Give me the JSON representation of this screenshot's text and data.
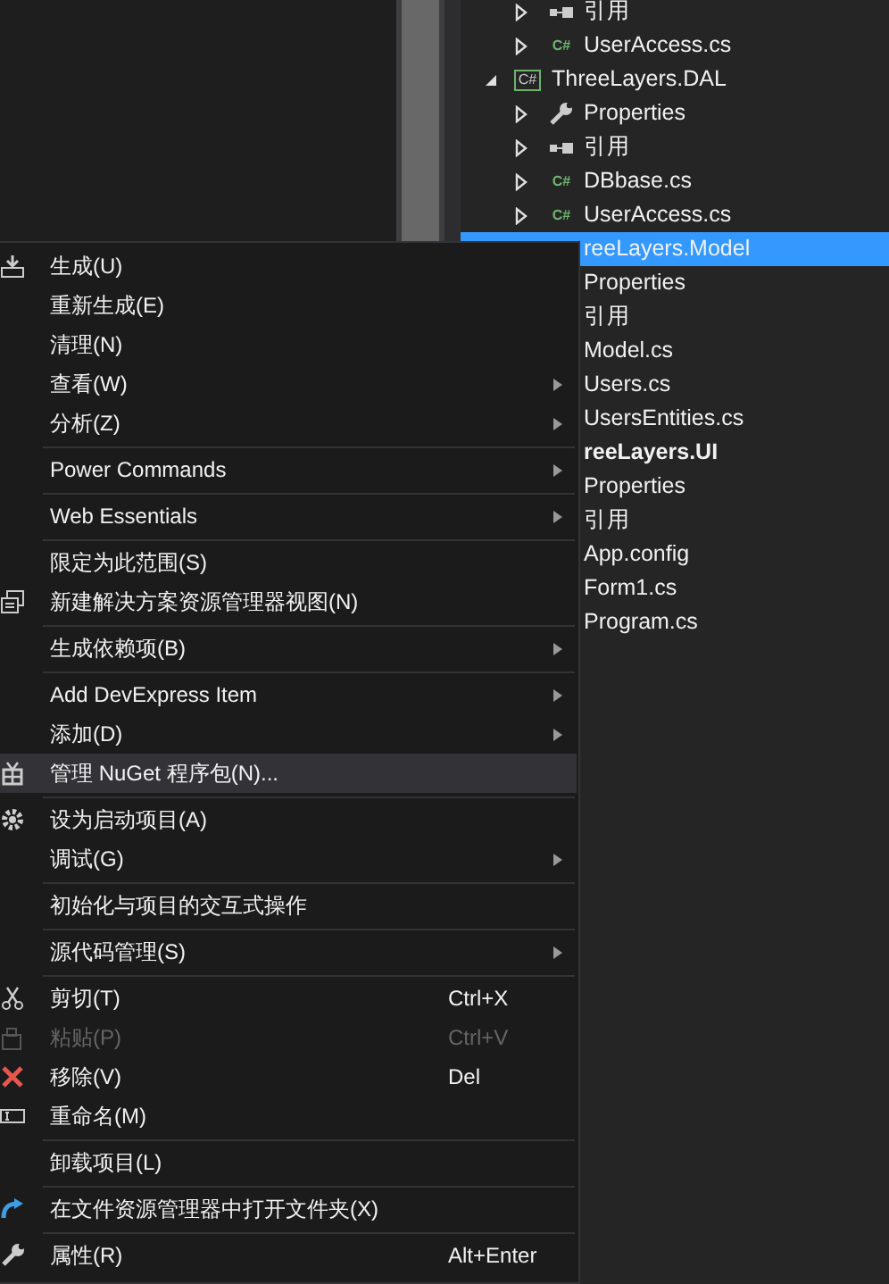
{
  "solution_explorer": {
    "leading_items": [
      {
        "label": "引用",
        "kind": "references",
        "expandable": true
      },
      {
        "label": "UserAccess.cs",
        "kind": "csharp",
        "icon_text": "C#",
        "expandable": true
      }
    ],
    "projects": [
      {
        "label": "ThreeLayers.DAL",
        "kind": "project",
        "icon_text": "C#",
        "expanded": true,
        "selected": false,
        "startup": false,
        "children": [
          {
            "label": "Properties",
            "kind": "properties",
            "expandable": true
          },
          {
            "label": "引用",
            "kind": "references",
            "expandable": true
          },
          {
            "label": "DBbase.cs",
            "kind": "csharp",
            "icon_text": "C#",
            "expandable": true
          },
          {
            "label": "UserAccess.cs",
            "kind": "csharp",
            "icon_text": "C#",
            "expandable": true
          }
        ]
      },
      {
        "label": "reeLayers.Model",
        "selected": true,
        "startup": false,
        "children": [
          {
            "label": "Properties"
          },
          {
            "label": "引用"
          },
          {
            "label": "Model.cs"
          },
          {
            "label": "Users.cs"
          },
          {
            "label": "UsersEntities.cs"
          }
        ]
      },
      {
        "label": "reeLayers.UI",
        "selected": false,
        "startup": true,
        "children": [
          {
            "label": "Properties"
          },
          {
            "label": "引用"
          },
          {
            "label": "App.config"
          },
          {
            "label": "Form1.cs"
          },
          {
            "label": "Program.cs"
          }
        ]
      }
    ]
  },
  "context_menu": [
    {
      "kind": "item",
      "label": "生成(U)",
      "submenu": false,
      "disabled": false,
      "selected": false
    },
    {
      "kind": "item",
      "label": "重新生成(E)",
      "submenu": false,
      "disabled": false,
      "selected": false
    },
    {
      "kind": "item",
      "label": "清理(N)",
      "submenu": false,
      "disabled": false,
      "selected": false
    },
    {
      "kind": "item",
      "label": "查看(W)",
      "submenu": true,
      "disabled": false,
      "selected": false
    },
    {
      "kind": "item",
      "label": "分析(Z)",
      "submenu": true,
      "disabled": false,
      "selected": false
    },
    {
      "kind": "separator"
    },
    {
      "kind": "item",
      "label": "Power Commands",
      "submenu": true,
      "disabled": false,
      "selected": false
    },
    {
      "kind": "separator"
    },
    {
      "kind": "item",
      "label": "Web Essentials",
      "submenu": true,
      "disabled": false,
      "selected": false
    },
    {
      "kind": "separator"
    },
    {
      "kind": "item",
      "label": "限定为此范围(S)",
      "submenu": false,
      "disabled": false,
      "selected": false
    },
    {
      "kind": "item",
      "label": "新建解决方案资源管理器视图(N)",
      "submenu": false,
      "disabled": false,
      "selected": false
    },
    {
      "kind": "separator"
    },
    {
      "kind": "item",
      "label": "生成依赖项(B)",
      "submenu": true,
      "disabled": false,
      "selected": false
    },
    {
      "kind": "separator"
    },
    {
      "kind": "item",
      "label": "Add DevExpress Item",
      "submenu": true,
      "disabled": false,
      "selected": false
    },
    {
      "kind": "item",
      "label": "添加(D)",
      "submenu": true,
      "disabled": false,
      "selected": false
    },
    {
      "kind": "item",
      "label": "管理 NuGet 程序包(N)...",
      "submenu": false,
      "disabled": false,
      "selected": true
    },
    {
      "kind": "separator"
    },
    {
      "kind": "item",
      "label": "设为启动项目(A)",
      "submenu": false,
      "disabled": false,
      "selected": false
    },
    {
      "kind": "item",
      "label": "调试(G)",
      "submenu": true,
      "disabled": false,
      "selected": false
    },
    {
      "kind": "separator"
    },
    {
      "kind": "item",
      "label": "初始化与项目的交互式操作",
      "submenu": false,
      "disabled": false,
      "selected": false
    },
    {
      "kind": "separator"
    },
    {
      "kind": "item",
      "label": "源代码管理(S)",
      "submenu": true,
      "disabled": false,
      "selected": false
    },
    {
      "kind": "separator"
    },
    {
      "kind": "item",
      "label": "剪切(T)",
      "shortcut": "Ctrl+X",
      "submenu": false,
      "disabled": false,
      "selected": false
    },
    {
      "kind": "item",
      "label": "粘贴(P)",
      "shortcut": "Ctrl+V",
      "submenu": false,
      "disabled": true,
      "selected": false
    },
    {
      "kind": "item",
      "label": "移除(V)",
      "shortcut": "Del",
      "submenu": false,
      "disabled": false,
      "selected": false
    },
    {
      "kind": "item",
      "label": "重命名(M)",
      "submenu": false,
      "disabled": false,
      "selected": false
    },
    {
      "kind": "separator"
    },
    {
      "kind": "item",
      "label": "卸载项目(L)",
      "submenu": false,
      "disabled": false,
      "selected": false
    },
    {
      "kind": "separator"
    },
    {
      "kind": "item",
      "label": "在文件资源管理器中打开文件夹(X)",
      "submenu": false,
      "disabled": false,
      "selected": false
    },
    {
      "kind": "separator"
    },
    {
      "kind": "item",
      "label": "属性(R)",
      "shortcut": "Alt+Enter",
      "submenu": false,
      "disabled": false,
      "selected": false
    }
  ]
}
